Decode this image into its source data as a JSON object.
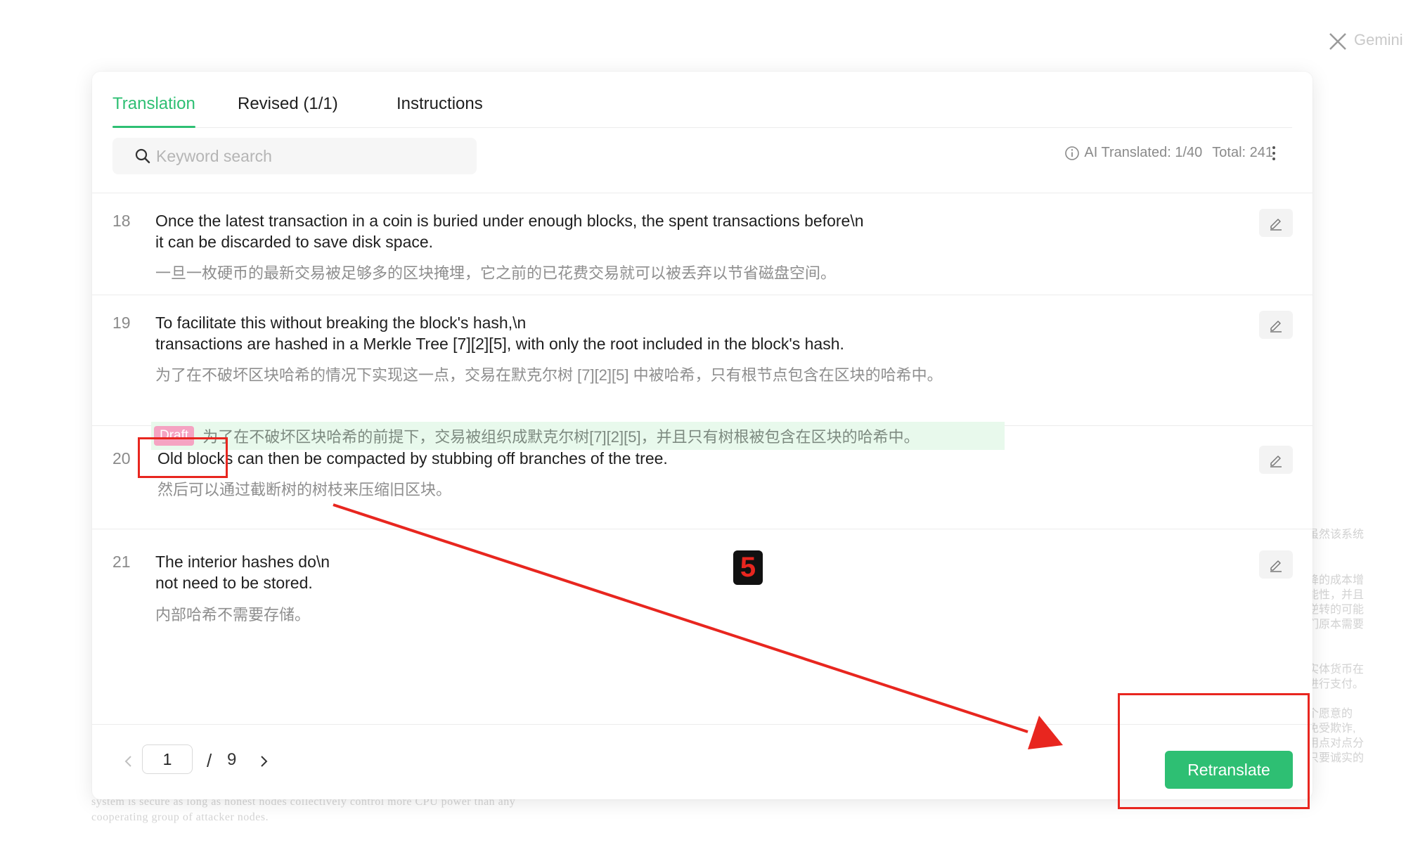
{
  "background": {
    "app_label": "Gemini",
    "right_snippets": [
      "虽然该系统",
      "降的成本增",
      "能性，并且",
      "逆转的可能",
      "们原本需要",
      "实体货币在",
      "进行支付。",
      "个愿意的",
      "免受欺诈,",
      "用点对点分",
      "只要诚实的"
    ],
    "bottom_snippets": [
      "system is secure as long as honest nodes collectively control more CPU power than any",
      "cooperating group of attacker nodes."
    ]
  },
  "tabs": [
    {
      "label": "Translation",
      "active": true
    },
    {
      "label": "Revised (1/1)",
      "active": false
    },
    {
      "label": "Instructions",
      "active": false
    }
  ],
  "search": {
    "placeholder": "Keyword search",
    "value": ""
  },
  "stats": {
    "ai_translated": "AI Translated: 1/40",
    "total": "Total: 241"
  },
  "segments": [
    {
      "number": "18",
      "source_lines": [
        "Once the latest transaction in a coin is buried under enough blocks, the spent transactions before\\n",
        "it can be discarded to save disk space."
      ],
      "translation": "一旦一枚硬币的最新交易被足够多的区块掩埋，它之前的已花费交易就可以被丢弃以节省磁盘空间。"
    },
    {
      "number": "19",
      "source_lines": [
        "To facilitate this without breaking the block's hash,\\n",
        "transactions are hashed in a Merkle Tree [7][2][5], with only the root included in the block's hash."
      ],
      "translation": "为了在不破坏区块哈希的情况下实现这一点，交易在默克尔树 [7][2][5] 中被哈希，只有根节点包含在区块的哈希中。",
      "draft_label": "Draft",
      "draft_text": "为了在不破坏区块哈希的前提下，交易被组织成默克尔树[7][2][5]，并且只有树根被包含在区块的哈希中。"
    },
    {
      "number": "20",
      "source_lines": [
        "Old blocks can then be compacted by stubbing off branches of the tree."
      ],
      "translation": "然后可以通过截断树的树枝来压缩旧区块。"
    },
    {
      "number": "21",
      "source_lines": [
        "The interior hashes do\\n",
        "not need to be stored."
      ],
      "translation": "内部哈希不需要存储。"
    }
  ],
  "pagination": {
    "current": "1",
    "separator": "/",
    "total": "9"
  },
  "actions": {
    "retranslate": "Retranslate"
  },
  "annotation": {
    "step": "5"
  },
  "colors": {
    "accent": "#2ebf73",
    "draft_bg": "#e8f9ec",
    "draft_badge": "#f5a3c2",
    "annotation": "#e8261f"
  }
}
